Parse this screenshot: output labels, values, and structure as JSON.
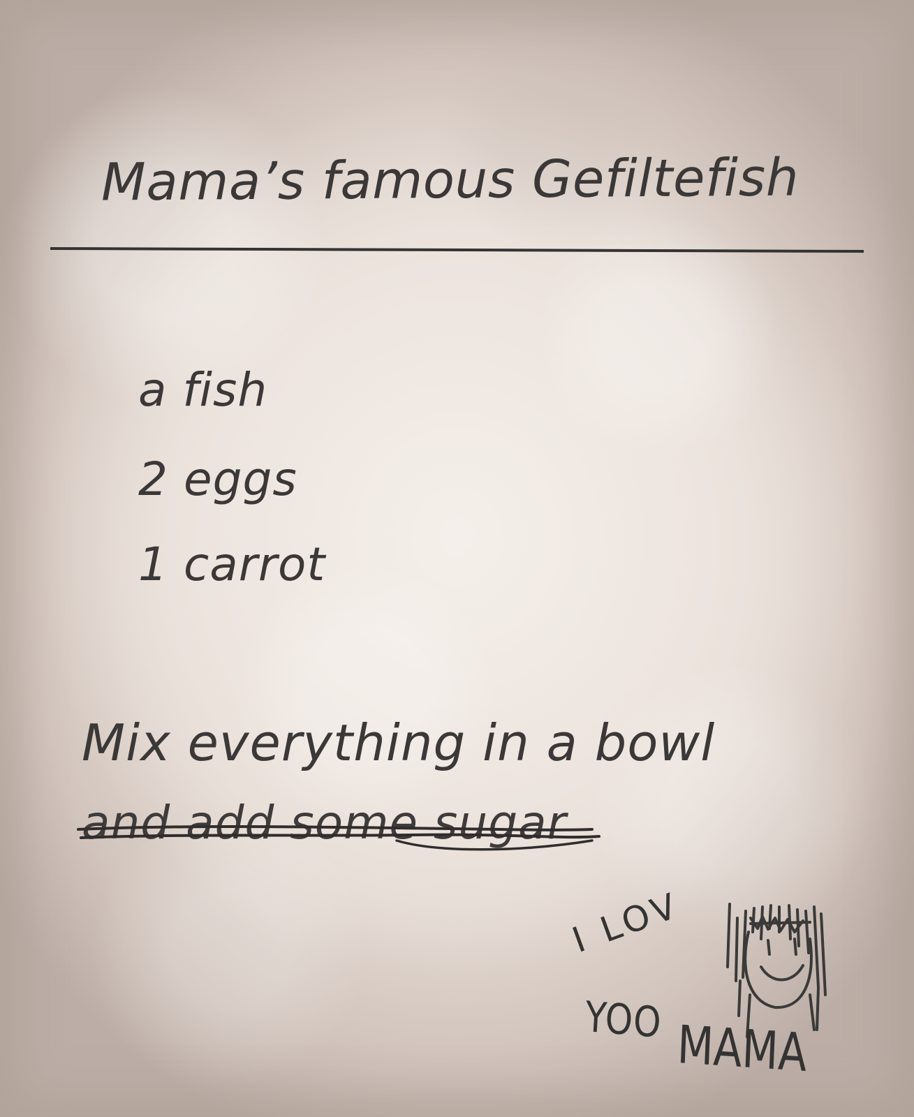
{
  "recipe": {
    "title": "Mama’s famous Gefiltefish",
    "ingredients": [
      "a fish",
      "2 eggs",
      "1 carrot"
    ],
    "instruction": "Mix everything in a bowl",
    "struck_instruction": "and add some sugar"
  },
  "doodle": {
    "line1": "I LOV",
    "line2": "YOO",
    "line3": "MAMA",
    "drawing": "smiley-face-portrait"
  },
  "colors": {
    "ink": "#3a3838",
    "paper": "#ede4de",
    "paper_edge": "#bcaea6"
  }
}
